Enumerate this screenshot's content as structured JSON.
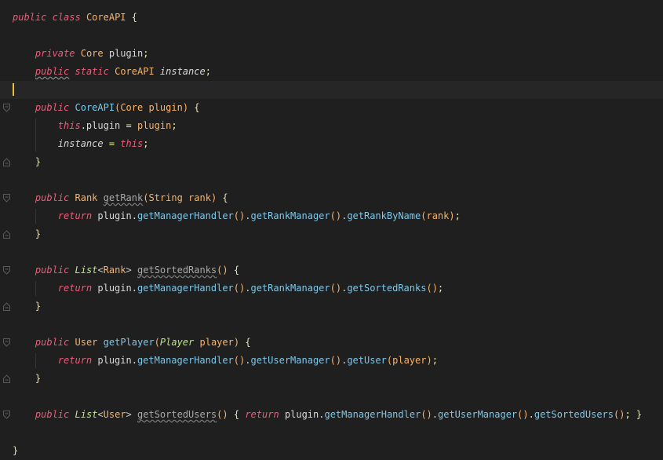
{
  "editor": {
    "colors": {
      "background": "#1f1f1f",
      "current_line": "#262626",
      "caret": "#e8c13a",
      "keyword": "#ee5c7b",
      "type": "#f9b36b",
      "function": "#7ec7e8",
      "plain": "#d8d8d8"
    },
    "icons": {
      "fold_open": "fold-open-icon",
      "fold_close": "fold-close-icon"
    },
    "lines": [
      {
        "fold": "none",
        "tokens": [
          {
            "t": "public",
            "c": "kw"
          },
          {
            "t": " ",
            "c": "pl"
          },
          {
            "t": "class",
            "c": "kw"
          },
          {
            "t": " ",
            "c": "pl"
          },
          {
            "t": "CoreAPI",
            "c": "ty"
          },
          {
            "t": " ",
            "c": "pl"
          },
          {
            "t": "{",
            "c": "br"
          }
        ]
      },
      {
        "fold": "none",
        "tokens": []
      },
      {
        "fold": "none",
        "tokens": [
          {
            "t": "    ",
            "c": "pl"
          },
          {
            "t": "private",
            "c": "kw"
          },
          {
            "t": " ",
            "c": "pl"
          },
          {
            "t": "Core",
            "c": "ty"
          },
          {
            "t": " ",
            "c": "pl"
          },
          {
            "t": "plugin",
            "c": "pl"
          },
          {
            "t": ";",
            "c": "pr"
          }
        ]
      },
      {
        "fold": "none",
        "tokens": [
          {
            "t": "    ",
            "c": "pl"
          },
          {
            "t": "public",
            "c": "kw warn"
          },
          {
            "t": " ",
            "c": "pl"
          },
          {
            "t": "static",
            "c": "kw"
          },
          {
            "t": " ",
            "c": "pl"
          },
          {
            "t": "CoreAPI",
            "c": "ty"
          },
          {
            "t": " ",
            "c": "pl"
          },
          {
            "t": "instance",
            "c": "it"
          },
          {
            "t": ";",
            "c": "pr"
          }
        ]
      },
      {
        "fold": "none",
        "current": true,
        "tokens": []
      },
      {
        "fold": "open",
        "tokens": [
          {
            "t": "    ",
            "c": "pl"
          },
          {
            "t": "public",
            "c": "kw"
          },
          {
            "t": " ",
            "c": "pl"
          },
          {
            "t": "CoreAPI",
            "c": "fn"
          },
          {
            "t": "(",
            "c": "pm"
          },
          {
            "t": "Core",
            "c": "ty"
          },
          {
            "t": " ",
            "c": "pl"
          },
          {
            "t": "plugin",
            "c": "pm"
          },
          {
            "t": ")",
            "c": "pm"
          },
          {
            "t": " ",
            "c": "pl"
          },
          {
            "t": "{",
            "c": "br"
          }
        ]
      },
      {
        "fold": "none",
        "tokens": [
          {
            "t": "        ",
            "c": "pl"
          },
          {
            "t": "this",
            "c": "kw"
          },
          {
            "t": ".plugin ",
            "c": "pl"
          },
          {
            "t": "=",
            "c": "pr"
          },
          {
            "t": " ",
            "c": "pl"
          },
          {
            "t": "plugin",
            "c": "pm"
          },
          {
            "t": ";",
            "c": "pr"
          }
        ]
      },
      {
        "fold": "none",
        "tokens": [
          {
            "t": "        ",
            "c": "pl"
          },
          {
            "t": "instance",
            "c": "it"
          },
          {
            "t": " ",
            "c": "pl"
          },
          {
            "t": "=",
            "c": "pr"
          },
          {
            "t": " ",
            "c": "pl"
          },
          {
            "t": "this",
            "c": "kw"
          },
          {
            "t": ";",
            "c": "pr"
          }
        ]
      },
      {
        "fold": "close",
        "tokens": [
          {
            "t": "    ",
            "c": "pl"
          },
          {
            "t": "}",
            "c": "br"
          }
        ]
      },
      {
        "fold": "none",
        "tokens": []
      },
      {
        "fold": "open",
        "tokens": [
          {
            "t": "    ",
            "c": "pl"
          },
          {
            "t": "public",
            "c": "kw"
          },
          {
            "t": " ",
            "c": "pl"
          },
          {
            "t": "Rank",
            "c": "ty"
          },
          {
            "t": " ",
            "c": "pl"
          },
          {
            "t": "getRank",
            "c": "unused"
          },
          {
            "t": "(",
            "c": "pm"
          },
          {
            "t": "String",
            "c": "ty"
          },
          {
            "t": " ",
            "c": "pl"
          },
          {
            "t": "rank",
            "c": "pm"
          },
          {
            "t": ")",
            "c": "pm"
          },
          {
            "t": " ",
            "c": "pl"
          },
          {
            "t": "{",
            "c": "br"
          }
        ]
      },
      {
        "fold": "none",
        "tokens": [
          {
            "t": "        ",
            "c": "pl"
          },
          {
            "t": "return",
            "c": "kw"
          },
          {
            "t": " plugin.",
            "c": "pl"
          },
          {
            "t": "getManagerHandler",
            "c": "fn"
          },
          {
            "t": "()",
            "c": "pm"
          },
          {
            "t": ".",
            "c": "pl"
          },
          {
            "t": "getRankManager",
            "c": "fn"
          },
          {
            "t": "()",
            "c": "pm"
          },
          {
            "t": ".",
            "c": "pl"
          },
          {
            "t": "getRankByName",
            "c": "fn"
          },
          {
            "t": "(",
            "c": "pm"
          },
          {
            "t": "rank",
            "c": "pm"
          },
          {
            "t": ")",
            "c": "pm"
          },
          {
            "t": ";",
            "c": "pr"
          }
        ]
      },
      {
        "fold": "close",
        "tokens": [
          {
            "t": "    ",
            "c": "pl"
          },
          {
            "t": "}",
            "c": "br"
          }
        ]
      },
      {
        "fold": "none",
        "tokens": []
      },
      {
        "fold": "open",
        "tokens": [
          {
            "t": "    ",
            "c": "pl"
          },
          {
            "t": "public",
            "c": "kw"
          },
          {
            "t": " ",
            "c": "pl"
          },
          {
            "t": "List",
            "c": "ifc"
          },
          {
            "t": "<",
            "c": "ang"
          },
          {
            "t": "Rank",
            "c": "ty"
          },
          {
            "t": ">",
            "c": "ang"
          },
          {
            "t": " ",
            "c": "pl"
          },
          {
            "t": "getSortedRanks",
            "c": "unused"
          },
          {
            "t": "()",
            "c": "pm"
          },
          {
            "t": " ",
            "c": "pl"
          },
          {
            "t": "{",
            "c": "br"
          }
        ]
      },
      {
        "fold": "none",
        "tokens": [
          {
            "t": "        ",
            "c": "pl"
          },
          {
            "t": "return",
            "c": "kw"
          },
          {
            "t": " plugin.",
            "c": "pl"
          },
          {
            "t": "getManagerHandler",
            "c": "fn"
          },
          {
            "t": "()",
            "c": "pm"
          },
          {
            "t": ".",
            "c": "pl"
          },
          {
            "t": "getRankManager",
            "c": "fn"
          },
          {
            "t": "()",
            "c": "pm"
          },
          {
            "t": ".",
            "c": "pl"
          },
          {
            "t": "getSortedRanks",
            "c": "fn"
          },
          {
            "t": "()",
            "c": "pm"
          },
          {
            "t": ";",
            "c": "pr"
          }
        ]
      },
      {
        "fold": "close",
        "tokens": [
          {
            "t": "    ",
            "c": "pl"
          },
          {
            "t": "}",
            "c": "br"
          }
        ]
      },
      {
        "fold": "none",
        "tokens": []
      },
      {
        "fold": "open",
        "tokens": [
          {
            "t": "    ",
            "c": "pl"
          },
          {
            "t": "public",
            "c": "kw"
          },
          {
            "t": " ",
            "c": "pl"
          },
          {
            "t": "User",
            "c": "ty"
          },
          {
            "t": " ",
            "c": "pl"
          },
          {
            "t": "getPlayer",
            "c": "fn"
          },
          {
            "t": "(",
            "c": "pm"
          },
          {
            "t": "Player",
            "c": "ifc"
          },
          {
            "t": " ",
            "c": "pl"
          },
          {
            "t": "player",
            "c": "pm"
          },
          {
            "t": ")",
            "c": "pm"
          },
          {
            "t": " ",
            "c": "pl"
          },
          {
            "t": "{",
            "c": "br"
          }
        ]
      },
      {
        "fold": "none",
        "tokens": [
          {
            "t": "        ",
            "c": "pl"
          },
          {
            "t": "return",
            "c": "kw"
          },
          {
            "t": " plugin.",
            "c": "pl"
          },
          {
            "t": "getManagerHandler",
            "c": "fn"
          },
          {
            "t": "()",
            "c": "pm"
          },
          {
            "t": ".",
            "c": "pl"
          },
          {
            "t": "getUserManager",
            "c": "fn"
          },
          {
            "t": "()",
            "c": "pm"
          },
          {
            "t": ".",
            "c": "pl"
          },
          {
            "t": "getUser",
            "c": "fn"
          },
          {
            "t": "(",
            "c": "pm"
          },
          {
            "t": "player",
            "c": "pm"
          },
          {
            "t": ")",
            "c": "pm"
          },
          {
            "t": ";",
            "c": "pr"
          }
        ]
      },
      {
        "fold": "close",
        "tokens": [
          {
            "t": "    ",
            "c": "pl"
          },
          {
            "t": "}",
            "c": "br"
          }
        ]
      },
      {
        "fold": "none",
        "tokens": []
      },
      {
        "fold": "open",
        "tokens": [
          {
            "t": "    ",
            "c": "pl"
          },
          {
            "t": "public",
            "c": "kw"
          },
          {
            "t": " ",
            "c": "pl"
          },
          {
            "t": "List",
            "c": "ifc"
          },
          {
            "t": "<",
            "c": "ang"
          },
          {
            "t": "User",
            "c": "ty"
          },
          {
            "t": ">",
            "c": "ang"
          },
          {
            "t": " ",
            "c": "pl"
          },
          {
            "t": "getSortedUsers",
            "c": "unused"
          },
          {
            "t": "()",
            "c": "pm"
          },
          {
            "t": " ",
            "c": "pl"
          },
          {
            "t": "{",
            "c": "br"
          },
          {
            "t": " ",
            "c": "pl"
          },
          {
            "t": "return",
            "c": "kw"
          },
          {
            "t": " plugin.",
            "c": "pl"
          },
          {
            "t": "getManagerHandler",
            "c": "fn"
          },
          {
            "t": "()",
            "c": "pm"
          },
          {
            "t": ".",
            "c": "pl"
          },
          {
            "t": "getUserManager",
            "c": "fn"
          },
          {
            "t": "()",
            "c": "pm"
          },
          {
            "t": ".",
            "c": "pl"
          },
          {
            "t": "getSortedUsers",
            "c": "fn"
          },
          {
            "t": "()",
            "c": "pm"
          },
          {
            "t": ";",
            "c": "pr"
          },
          {
            "t": " ",
            "c": "pl"
          },
          {
            "t": "}",
            "c": "br"
          }
        ]
      },
      {
        "fold": "none",
        "tokens": []
      },
      {
        "fold": "none",
        "tokens": [
          {
            "t": "}",
            "c": "br"
          }
        ]
      }
    ]
  }
}
